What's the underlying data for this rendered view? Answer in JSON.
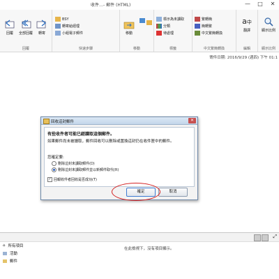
{
  "window": {
    "title": "收件…- 郵件 (HTML)",
    "buttons": [
      "—",
      "□",
      "✕"
    ]
  },
  "ribbon": {
    "groups": [
      {
        "id": "delete",
        "label": "回覆",
        "buttons": [
          "回覆",
          "全部回覆",
          "轉寄"
        ]
      },
      {
        "id": "quick",
        "label": "快速步驟",
        "items": [
          "BSY",
          "轉寄給經理",
          "小組電子郵件"
        ]
      },
      {
        "id": "move",
        "label": "移動",
        "buttons": [
          "移動"
        ]
      },
      {
        "id": "tags",
        "label": "標籤",
        "items": [
          "標示為未讀取",
          "分類",
          "待處理"
        ]
      },
      {
        "id": "chinese",
        "label": "中文繁簡轉換",
        "items": [
          "繁轉簡",
          "簡轉繁",
          "中文繁簡轉換"
        ]
      },
      {
        "id": "edit",
        "label": "編輯",
        "buttons": [
          "翻譯"
        ]
      },
      {
        "id": "zoom",
        "label": "顯示比例",
        "buttons": [
          "顯示比例"
        ]
      }
    ]
  },
  "info": {
    "sent": "寄件日期:   2016/9/29 (週四) 下午 01:1"
  },
  "dialog": {
    "title": "回收這封郵件",
    "heading": "有些收件者可能已經讀取這個郵件。",
    "desc": "如果郵件尚未被讀取，郵件回收可以刪除或置換這封仍在收件匣中的郵件。",
    "question": "您確定要:",
    "options": [
      "刪除這封未讀取郵件(D)",
      "刪除這封未讀取郵件並以新郵件取代(R)"
    ],
    "checkbox": "回報收件者回收是否成功(T)",
    "ok": "確定",
    "cancel": "取消"
  },
  "bottom": {
    "empty_text": "在此檢視下，沒有項目顯示。",
    "nav": [
      "所有項目",
      "活動",
      "郵件"
    ]
  },
  "colors": {
    "accent": "#2a5fbf",
    "highlight_ring": "#d42020"
  }
}
